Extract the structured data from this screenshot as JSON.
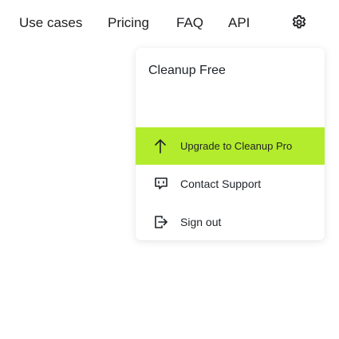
{
  "nav": {
    "use_cases": "Use cases",
    "pricing": "Pricing",
    "faq": "FAQ",
    "api": "API",
    "settings_icon": "gear-icon"
  },
  "menu": {
    "plan_name": "Cleanup Free",
    "upgrade": {
      "label": "Upgrade to Cleanup Pro",
      "icon": "arrow-up-icon",
      "color": "#b3ec2c"
    },
    "contact": {
      "label": "Contact Support",
      "icon": "chat-bubble-icon"
    },
    "signout": {
      "label": "Sign out",
      "icon": "sign-out-icon"
    }
  }
}
